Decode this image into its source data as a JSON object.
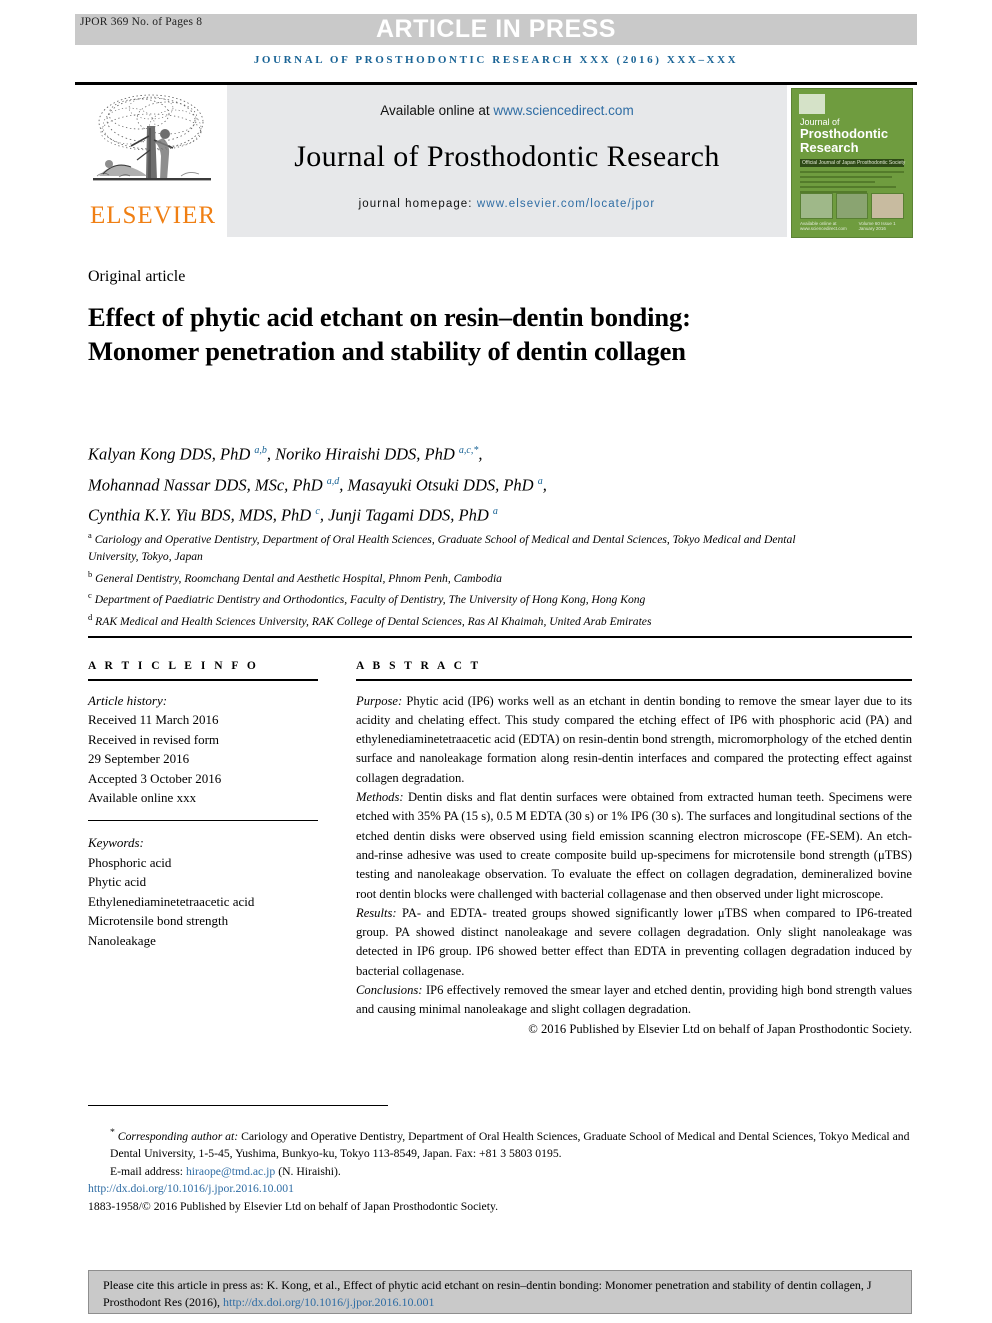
{
  "header": {
    "stamp": "JPOR 369 No. of Pages 8",
    "banner": "ARTICLE IN PRESS",
    "journal_running_head": "JOURNAL OF PROSTHODONTIC RESEARCH XXX (2016) XXX–XXX"
  },
  "masthead": {
    "available_label": "Available online at ",
    "sciencedirect_url": "www.sciencedirect.com",
    "journal_name": "Journal of Prosthodontic Research",
    "homepage_label": "journal homepage: ",
    "homepage_url": "www.elsevier.com/locate/jpor",
    "publisher_wordmark": "ELSEVIER",
    "publisher_color": "#f07f13",
    "cover": {
      "line1": "Journal of",
      "line2": "Prosthodontic",
      "line3": "Research",
      "society_bar": "Official Journal of Japan Prosthodontic Society",
      "volume_left": "Available online at\nwww.sciencedirect.com",
      "volume_right": "Volume 60 Issue 1\nJanuary 2016",
      "bg_color": "#6f9c3f"
    }
  },
  "article": {
    "kicker": "Original article",
    "title": "Effect of phytic acid etchant on resin–dentin bonding: Monomer penetration and stability of dentin collagen",
    "authors_lines": [
      "Kalyan Kong DDS, PhD",
      "Noriko Hiraishi DDS, PhD",
      "Mohannad Nassar DDS, MSc, PhD",
      "Masayuki Otsuki DDS, PhD",
      "Cynthia K.Y. Yiu BDS, MDS, PhD",
      "Junji Tagami DDS, PhD"
    ],
    "author_marks": [
      "a,b",
      "a,c,*",
      "a,d",
      "a",
      "c",
      "a"
    ],
    "affiliations": [
      {
        "mark": "a",
        "text": "Cariology and Operative Dentistry, Department of Oral Health Sciences, Graduate School of Medical and Dental Sciences, Tokyo Medical and Dental University, Tokyo, Japan"
      },
      {
        "mark": "b",
        "text": "General Dentistry, Roomchang Dental and Aesthetic Hospital, Phnom Penh, Cambodia"
      },
      {
        "mark": "c",
        "text": "Department of Paediatric Dentistry and Orthodontics, Faculty of Dentistry, The University of Hong Kong, Hong Kong"
      },
      {
        "mark": "d",
        "text": "RAK Medical and Health Sciences University, RAK College of Dental Sciences, Ras Al Khaimah, United Arab Emirates"
      }
    ]
  },
  "article_info": {
    "heading": "A R T I C L E  I N F O",
    "history_label": "Article history:",
    "history": [
      "Received 11 March 2016",
      "Received in revised form",
      "29 September 2016",
      "Accepted 3 October 2016",
      "Available online xxx"
    ],
    "keywords_label": "Keywords:",
    "keywords": [
      "Phosphoric acid",
      "Phytic acid",
      "Ethylenediaminetetraacetic acid",
      "Microtensile bond strength",
      "Nanoleakage"
    ]
  },
  "abstract": {
    "heading": "A B S T R A C T",
    "sections": [
      {
        "label": "Purpose:",
        "text": " Phytic acid (IP6) works well as an etchant in dentin bonding to remove the smear layer due to its acidity and chelating effect. This study compared the etching effect of IP6 with phosphoric acid (PA) and ethylenediaminetetraacetic acid (EDTA) on resin-dentin bond strength, micromorphology of the etched dentin surface and nanoleakage formation along resin-dentin interfaces and compared the protecting effect against collagen degradation."
      },
      {
        "label": "Methods:",
        "text": " Dentin disks and flat dentin surfaces were obtained from extracted human teeth. Specimens were etched with 35% PA (15 s), 0.5 M EDTA (30 s) or 1% IP6 (30 s). The surfaces and longitudinal sections of the etched dentin disks were observed using field emission scanning electron microscope (FE-SEM). An etch-and-rinse adhesive was used to create composite build up-specimens for microtensile bond strength (μTBS) testing and nanoleakage observation. To evaluate the effect on collagen degradation, demineralized bovine root dentin blocks were challenged with bacterial collagenase and then observed under light microscope."
      },
      {
        "label": "Results:",
        "text": " PA- and EDTA- treated groups showed significantly lower μTBS when compared to IP6-treated group. PA showed distinct nanoleakage and severe collagen degradation. Only slight nanoleakage was detected in IP6 group. IP6 showed better effect than EDTA in preventing collagen degradation induced by bacterial collagenase."
      },
      {
        "label": "Conclusions:",
        "text": " IP6 effectively removed the smear layer and etched dentin, providing high bond strength values and causing minimal nanoleakage and slight collagen degradation."
      }
    ],
    "copyright": "© 2016 Published by Elsevier Ltd on behalf of Japan Prosthodontic Society."
  },
  "footer": {
    "corresponding_label": "Corresponding author at:",
    "corresponding_text": " Cariology and Operative Dentistry, Department of Oral Health Sciences, Graduate School of Medical and Dental Sciences, Tokyo Medical and Dental University, 1-5-45, Yushima, Bunkyo-ku, Tokyo 113-8549, Japan. Fax: +81 3 5803 0195.",
    "email_label": "E-mail address: ",
    "email": "hiraope@tmd.ac.jp",
    "email_suffix": " (N. Hiraishi).",
    "doi": "http://dx.doi.org/10.1016/j.jpor.2016.10.001",
    "issn_line": "1883-1958/© 2016 Published by Elsevier Ltd on behalf of Japan Prosthodontic Society."
  },
  "citation_box": {
    "text": "Please cite this article in press as: K. Kong, et al., Effect of phytic acid etchant on resin–dentin bonding: Monomer penetration and stability of dentin collagen, J Prosthodont Res (2016), ",
    "link": "http://dx.doi.org/10.1016/j.jpor.2016.10.001"
  },
  "colors": {
    "link_blue": "#2f6da4",
    "running_head_blue": "#1a6496",
    "band_gray": "#c9c9c9",
    "mast_gray": "#e7e8ea"
  }
}
